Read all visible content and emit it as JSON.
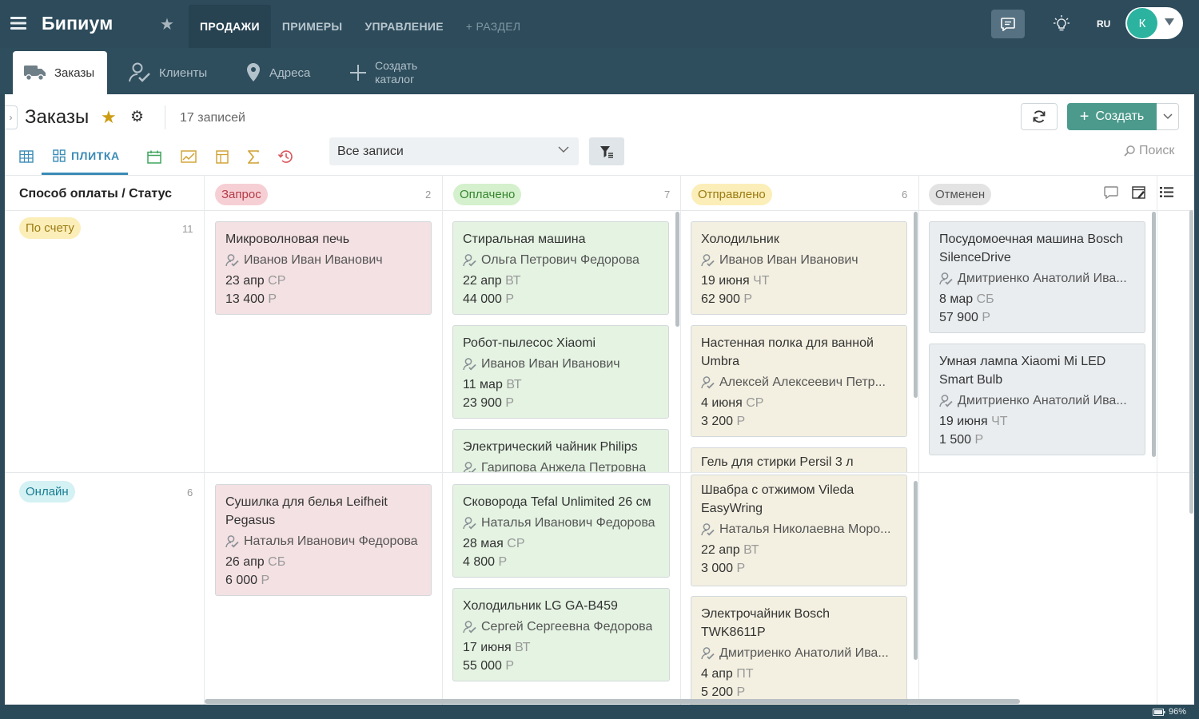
{
  "app": {
    "logo": "Бипиум",
    "nav": [
      "ПРОДАЖИ",
      "ПРИМЕРЫ",
      "УПРАВЛЕНИЕ"
    ],
    "nav_add": "+ РАЗДЕЛ",
    "lang": "RU",
    "avatar_letter": "К"
  },
  "subtabs": {
    "orders": "Заказы",
    "clients": "Клиенты",
    "addresses": "Адреса",
    "create_line1": "Создать",
    "create_line2": "каталог"
  },
  "page": {
    "title": "Заказы",
    "count": "17 записей",
    "create_label": "Создать",
    "view_tile_label": "ПЛИТКА",
    "filter_value": "Все записи",
    "search_label": "Поиск",
    "group_header": "Способ оплаты / Статус"
  },
  "statuses": [
    {
      "label": "Запрос",
      "count": "2",
      "color": "#f6cfd4"
    },
    {
      "label": "Оплачено",
      "count": "7",
      "color": "#d4f0cc"
    },
    {
      "label": "Отправлено",
      "count": "6",
      "color": "#fbeeb8"
    },
    {
      "label": "Отменен",
      "count": "",
      "color": "#e3e3e3"
    }
  ],
  "rows": [
    {
      "label": "По счету",
      "count": "11",
      "color": "#fbeeb8"
    },
    {
      "label": "Онлайн",
      "count": "6",
      "color": "#d4f1f4"
    }
  ],
  "cards": {
    "r1c1": [
      {
        "title": "Микроволновая печь",
        "person": "Иванов Иван Иванович",
        "date": "23 апр",
        "day": "СР",
        "amount": "13 400",
        "cur": "Р"
      }
    ],
    "r1c2": [
      {
        "title": "Стиральная машина",
        "person": "Ольга Петрович Федорова",
        "date": "22 апр",
        "day": "ВТ",
        "amount": "44 000",
        "cur": "Р"
      },
      {
        "title": "Робот-пылесос Xiaomi",
        "person": "Иванов Иван Иванович",
        "date": "11 мар",
        "day": "ВТ",
        "amount": "23 900",
        "cur": "Р"
      },
      {
        "title": "Электрический чайник Philips",
        "person": "Гарипова Анжела Петровна"
      }
    ],
    "r1c3": [
      {
        "title": "Холодильник",
        "person": "Иванов Иван Иванович",
        "date": "19 июня",
        "day": "ЧТ",
        "amount": "62 900",
        "cur": "Р"
      },
      {
        "title": "Настенная полка для ванной Umbra",
        "person": "Алексей Алексеевич Петр...",
        "date": "4 июня",
        "day": "СР",
        "amount": "3 200",
        "cur": "Р"
      },
      {
        "title": "Гель для стирки Persil 3 л"
      }
    ],
    "r1c4": [
      {
        "title": "Посудомоечная машина Bosch SilenceDrive",
        "person": "Дмитриенко Анатолий Ива...",
        "date": "8 мар",
        "day": "СБ",
        "amount": "57 900",
        "cur": "Р"
      },
      {
        "title": "Умная лампа Xiaomi Mi LED Smart Bulb",
        "person": "Дмитриенко Анатолий Ива...",
        "date": "19 июня",
        "day": "ЧТ",
        "amount": "1 500",
        "cur": "Р"
      }
    ],
    "r2c1": [
      {
        "title": "Сушилка для белья Leifheit Pegasus",
        "person": "Наталья Иванович Федорова",
        "date": "26 апр",
        "day": "СБ",
        "amount": "6 000",
        "cur": "Р"
      }
    ],
    "r2c2": [
      {
        "title": "Сковорода Tefal Unlimited 26 см",
        "person": "Наталья Иванович Федорова",
        "date": "28 мая",
        "day": "СР",
        "amount": "4 800",
        "cur": "Р"
      },
      {
        "title": "Холодильник LG GA-B459",
        "person": "Сергей Сергеевна Федорова",
        "date": "17 июня",
        "day": "ВТ",
        "amount": "55 000",
        "cur": "Р"
      }
    ],
    "r2c3": [
      {
        "title": "Швабра с отжимом Vileda EasyWring",
        "person": "Наталья Николаевна Моро...",
        "date": "22 апр",
        "day": "ВТ",
        "amount": "3 000",
        "cur": "Р"
      },
      {
        "title": "Электрочайник Bosch TWK8611P",
        "person": "Дмитриенко Анатолий Ива...",
        "date": "4 апр",
        "day": "ПТ",
        "amount": "5 200",
        "cur": "Р"
      }
    ]
  },
  "status_bar": {
    "battery": "96%"
  }
}
